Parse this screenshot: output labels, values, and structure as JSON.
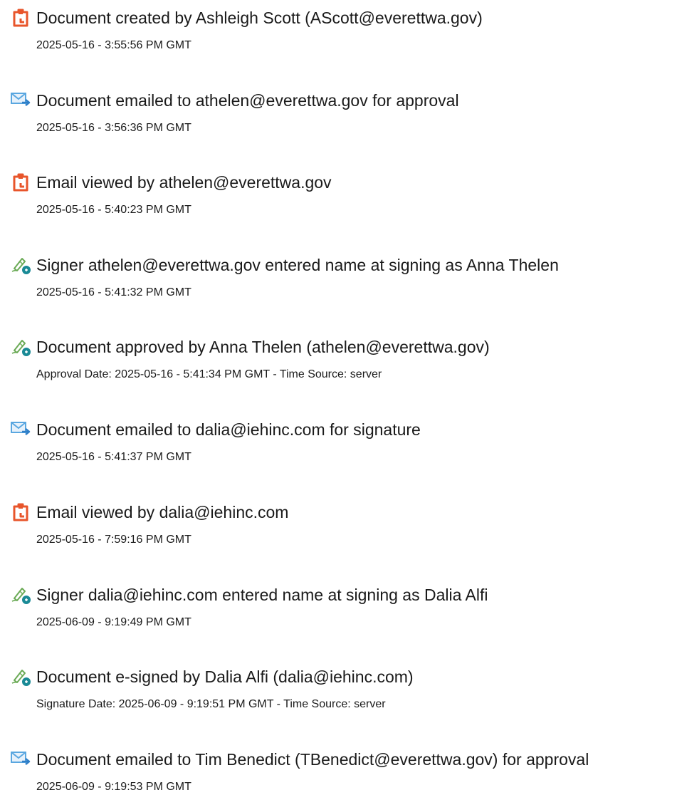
{
  "events": [
    {
      "icon": "document-created-icon",
      "title": "Document created by Ashleigh Scott (AScott@everettwa.gov)",
      "detail": "2025-05-16 - 3:55:56 PM GMT"
    },
    {
      "icon": "email-sent-icon",
      "title": "Document emailed to athelen@everettwa.gov for approval",
      "detail": "2025-05-16 - 3:56:36 PM GMT"
    },
    {
      "icon": "document-viewed-icon",
      "title": "Email viewed by athelen@everettwa.gov",
      "detail": "2025-05-16 - 5:40:23 PM GMT"
    },
    {
      "icon": "signer-pen-icon",
      "title": "Signer athelen@everettwa.gov entered name at signing as Anna Thelen",
      "detail": "2025-05-16 - 5:41:32 PM GMT"
    },
    {
      "icon": "signer-pen-icon",
      "title": "Document approved by Anna Thelen (athelen@everettwa.gov)",
      "detail": "Approval Date: 2025-05-16 - 5:41:34 PM GMT - Time Source: server"
    },
    {
      "icon": "email-sent-icon",
      "title": "Document emailed to dalia@iehinc.com for signature",
      "detail": "2025-05-16 - 5:41:37 PM GMT"
    },
    {
      "icon": "document-viewed-icon",
      "title": "Email viewed by dalia@iehinc.com",
      "detail": "2025-05-16 - 7:59:16 PM GMT"
    },
    {
      "icon": "signer-pen-icon",
      "title": "Signer dalia@iehinc.com entered name at signing as Dalia Alfi",
      "detail": "2025-06-09 - 9:19:49 PM GMT"
    },
    {
      "icon": "signer-pen-icon",
      "title": "Document e-signed by Dalia Alfi (dalia@iehinc.com)",
      "detail": "Signature Date: 2025-06-09 - 9:19:51 PM GMT - Time Source: server"
    },
    {
      "icon": "email-sent-icon",
      "title": "Document emailed to Tim Benedict (TBenedict@everettwa.gov) for approval",
      "detail": "2025-06-09 - 9:19:53 PM GMT"
    }
  ],
  "colors": {
    "document_icon": "#e8552b",
    "email_icon": "#5aa7e0",
    "pen_icon": "#6aaa55",
    "pen_badge": "#1a8a96"
  }
}
